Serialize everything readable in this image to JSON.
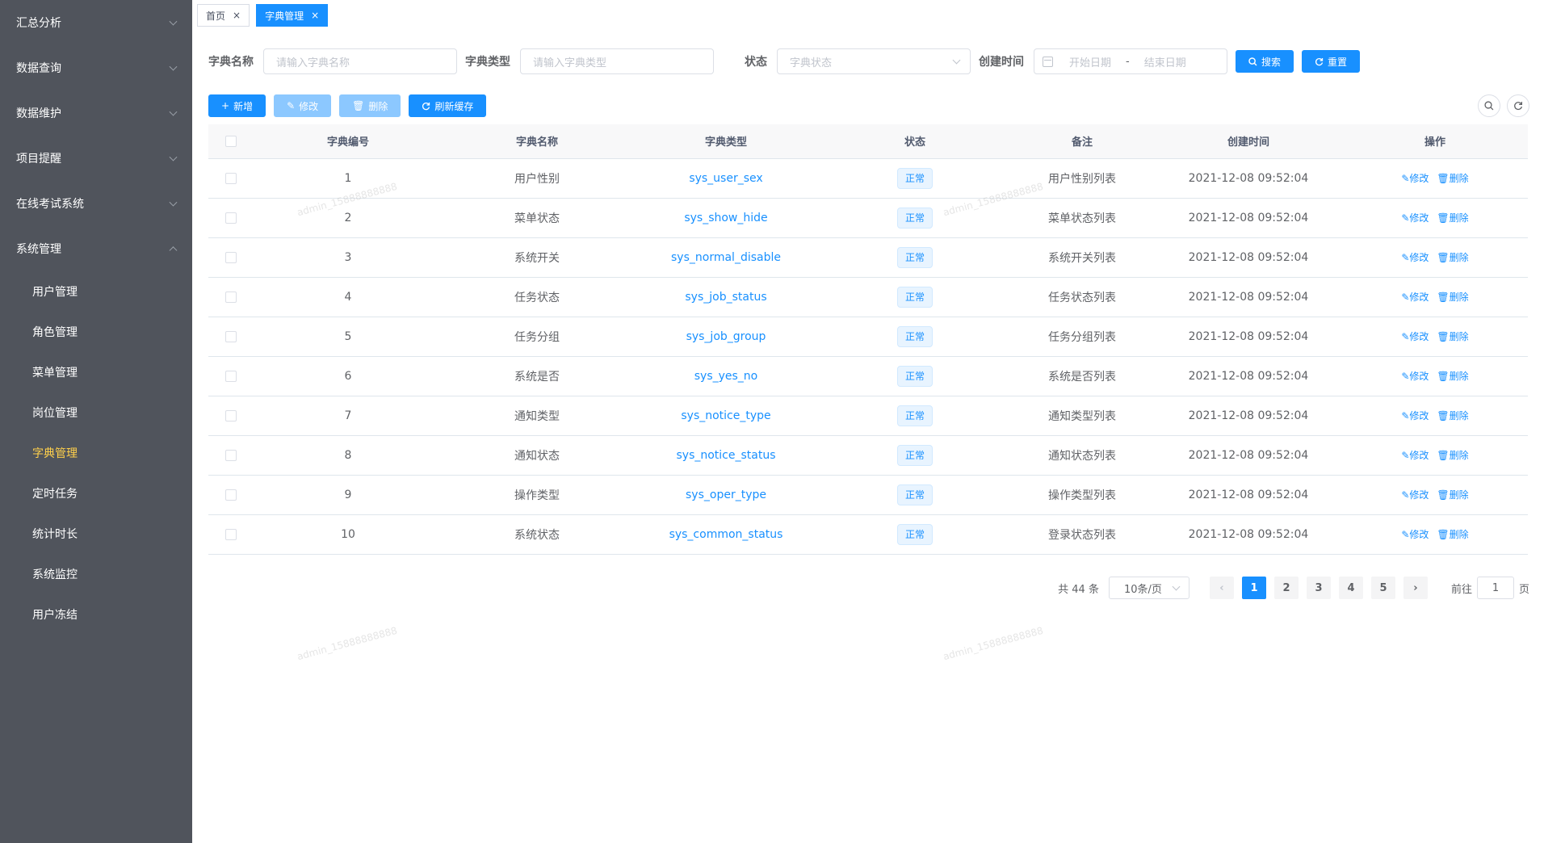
{
  "sidebar": {
    "menus": [
      {
        "label": "汇总分析",
        "expanded": false
      },
      {
        "label": "数据查询",
        "expanded": false
      },
      {
        "label": "数据维护",
        "expanded": false
      },
      {
        "label": "项目提醒",
        "expanded": false
      },
      {
        "label": "在线考试系统",
        "expanded": false
      },
      {
        "label": "系统管理",
        "expanded": true
      }
    ],
    "sub_items": [
      {
        "label": "用户管理"
      },
      {
        "label": "角色管理"
      },
      {
        "label": "菜单管理"
      },
      {
        "label": "岗位管理"
      },
      {
        "label": "字典管理",
        "active": true
      },
      {
        "label": "定时任务"
      },
      {
        "label": "统计时长"
      },
      {
        "label": "系统监控"
      },
      {
        "label": "用户冻结"
      }
    ]
  },
  "tags": [
    {
      "label": "首页",
      "active": false
    },
    {
      "label": "字典管理",
      "active": true
    }
  ],
  "search": {
    "dict_name_label": "字典名称",
    "dict_name_placeholder": "请输入字典名称",
    "dict_type_label": "字典类型",
    "dict_type_placeholder": "请输入字典类型",
    "status_label": "状态",
    "status_placeholder": "字典状态",
    "create_time_label": "创建时间",
    "start_date_placeholder": "开始日期",
    "date_separator": "-",
    "end_date_placeholder": "结束日期",
    "search_button": "搜索",
    "reset_button": "重置"
  },
  "toolbar": {
    "add": "新增",
    "edit": "修改",
    "delete": "删除",
    "refresh_cache": "刷新缓存"
  },
  "table": {
    "headers": [
      "字典编号",
      "字典名称",
      "字典类型",
      "状态",
      "备注",
      "创建时间",
      "操作"
    ],
    "rows": [
      {
        "id": "1",
        "name": "用户性别",
        "type": "sys_user_sex",
        "status": "正常",
        "remark": "用户性别列表",
        "time": "2021-12-08 09:52:04"
      },
      {
        "id": "2",
        "name": "菜单状态",
        "type": "sys_show_hide",
        "status": "正常",
        "remark": "菜单状态列表",
        "time": "2021-12-08 09:52:04"
      },
      {
        "id": "3",
        "name": "系统开关",
        "type": "sys_normal_disable",
        "status": "正常",
        "remark": "系统开关列表",
        "time": "2021-12-08 09:52:04"
      },
      {
        "id": "4",
        "name": "任务状态",
        "type": "sys_job_status",
        "status": "正常",
        "remark": "任务状态列表",
        "time": "2021-12-08 09:52:04"
      },
      {
        "id": "5",
        "name": "任务分组",
        "type": "sys_job_group",
        "status": "正常",
        "remark": "任务分组列表",
        "time": "2021-12-08 09:52:04"
      },
      {
        "id": "6",
        "name": "系统是否",
        "type": "sys_yes_no",
        "status": "正常",
        "remark": "系统是否列表",
        "time": "2021-12-08 09:52:04"
      },
      {
        "id": "7",
        "name": "通知类型",
        "type": "sys_notice_type",
        "status": "正常",
        "remark": "通知类型列表",
        "time": "2021-12-08 09:52:04"
      },
      {
        "id": "8",
        "name": "通知状态",
        "type": "sys_notice_status",
        "status": "正常",
        "remark": "通知状态列表",
        "time": "2021-12-08 09:52:04"
      },
      {
        "id": "9",
        "name": "操作类型",
        "type": "sys_oper_type",
        "status": "正常",
        "remark": "操作类型列表",
        "time": "2021-12-08 09:52:04"
      },
      {
        "id": "10",
        "name": "系统状态",
        "type": "sys_common_status",
        "status": "正常",
        "remark": "登录状态列表",
        "time": "2021-12-08 09:52:04"
      }
    ],
    "op_edit": "修改",
    "op_delete": "删除"
  },
  "pagination": {
    "total_text": "共 44 条",
    "page_size": "10条/页",
    "pages": [
      "1",
      "2",
      "3",
      "4",
      "5"
    ],
    "current": "1",
    "goto_prefix": "前往",
    "goto_value": "1",
    "goto_suffix": "页"
  },
  "watermark": "admin_15888888888",
  "colors": {
    "sidebar_bg": "#50545c",
    "primary": "#1890ff",
    "active_menu": "#ffd04b"
  }
}
